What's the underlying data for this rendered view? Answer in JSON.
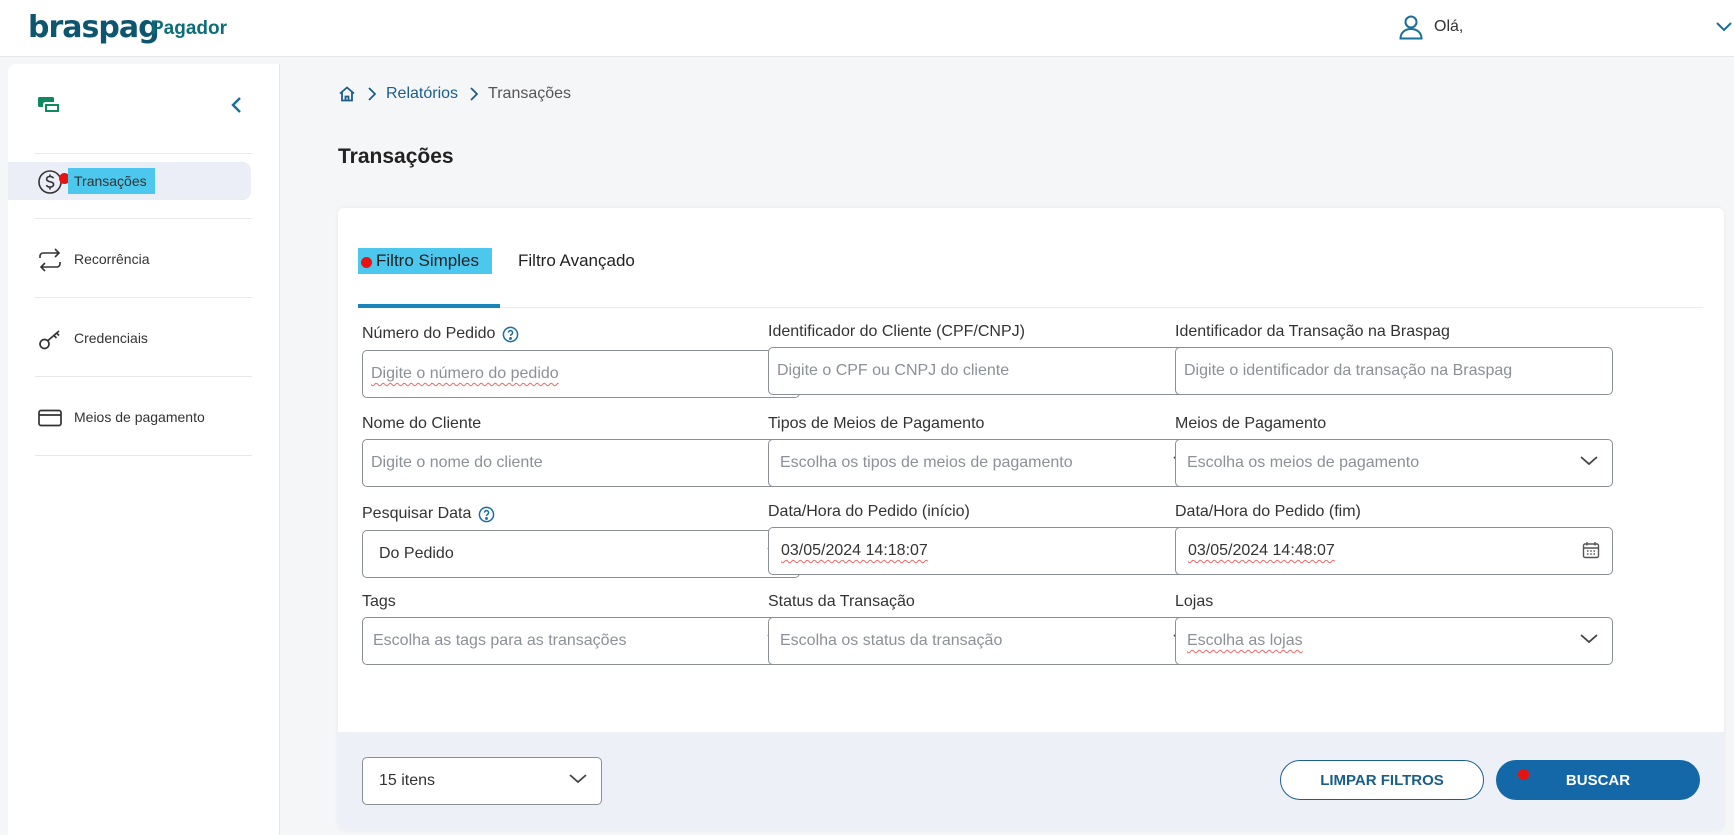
{
  "header": {
    "logo_text": "braspag",
    "product": "Pagador",
    "greeting": "Olá,"
  },
  "sidebar": {
    "items": [
      {
        "label": "Transações",
        "icon": "dollar-circle-icon",
        "active": true
      },
      {
        "label": "Recorrência",
        "icon": "repeat-arrows-icon"
      },
      {
        "label": "Credenciais",
        "icon": "key-icon"
      },
      {
        "label": "Meios de pagamento",
        "icon": "credit-card-icon"
      }
    ]
  },
  "breadcrumb": {
    "items": [
      "Relatórios",
      "Transações"
    ]
  },
  "page": {
    "title": "Transações"
  },
  "tabs": [
    {
      "label": "Filtro Simples",
      "active": true
    },
    {
      "label": "Filtro Avançado",
      "active": false
    }
  ],
  "form": {
    "order_number": {
      "label": "Número do Pedido",
      "placeholder": "Digite o número do pedido"
    },
    "customer_id": {
      "label": "Identificador do Cliente (CPF/CNPJ)",
      "placeholder": "Digite o CPF ou CNPJ do cliente"
    },
    "transaction_id": {
      "label": "Identificador da Transação na Braspag",
      "placeholder": "Digite o identificador da transação na Braspag"
    },
    "customer_name": {
      "label": "Nome do Cliente",
      "placeholder": "Digite o nome do cliente"
    },
    "payment_types": {
      "label": "Tipos de Meios de Pagamento",
      "placeholder": "Escolha os tipos de meios de pagamento"
    },
    "payment_methods": {
      "label": "Meios de Pagamento",
      "placeholder": "Escolha os meios de pagamento"
    },
    "date_search": {
      "label": "Pesquisar Data",
      "value": "Do Pedido"
    },
    "date_start": {
      "label": "Data/Hora do Pedido (início)",
      "value": "03/05/2024 14:18:07"
    },
    "date_end": {
      "label": "Data/Hora do Pedido (fim)",
      "value": "03/05/2024 14:48:07"
    },
    "tags": {
      "label": "Tags",
      "placeholder": "Escolha as tags para as transações"
    },
    "status": {
      "label": "Status da Transação",
      "placeholder": "Escolha os status da transação"
    },
    "stores": {
      "label": "Lojas",
      "placeholder": "Escolha as lojas"
    }
  },
  "footer": {
    "page_size": "15 itens",
    "clear_label": "LIMPAR FILTROS",
    "search_label": "BUSCAR"
  },
  "colors": {
    "brand": "#0e5570",
    "primary_button": "#1468a8",
    "highlight": "#4cc8ef",
    "marker": "#e8120f"
  }
}
